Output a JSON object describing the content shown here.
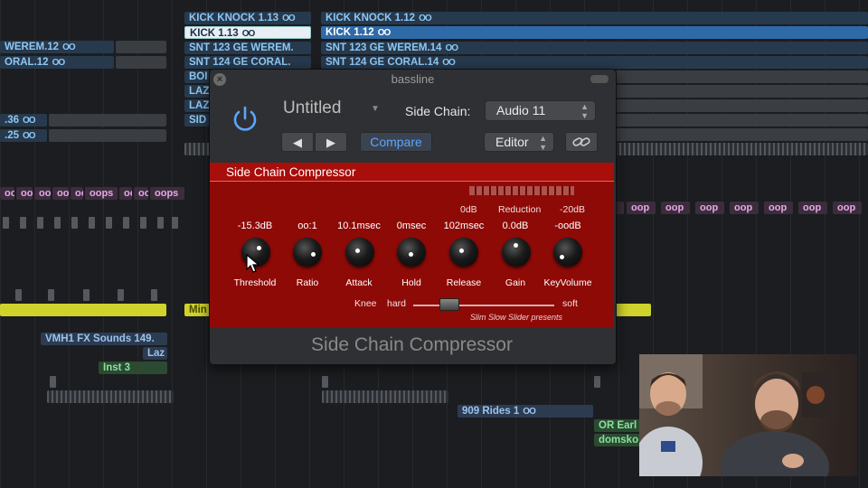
{
  "tracks": {
    "left_regions": [
      {
        "label": "WEREM.12",
        "link": "OO"
      },
      {
        "label": "ORAL.12",
        "link": "OO"
      },
      {
        "label": ".36",
        "link": "OO"
      },
      {
        "label": ".25",
        "link": "OO"
      }
    ],
    "mid_regions": [
      {
        "label": "KICK KNOCK  1.13",
        "link": "OO"
      },
      {
        "label": "KICK  1.13",
        "link": "OO"
      },
      {
        "label": "SNT  123  GE  WEREM.",
        "link": ""
      },
      {
        "label": "SNT  124  GE  CORAL.",
        "link": ""
      },
      {
        "label": "BOI",
        "link": ""
      },
      {
        "label": "LAZ",
        "link": ""
      },
      {
        "label": "LAZ",
        "link": ""
      },
      {
        "label": "SID",
        "link": ""
      }
    ],
    "right_regions": [
      {
        "label": "KICK KNOCK  1.12",
        "link": "OO"
      },
      {
        "label": "KICK  1.12",
        "link": "OO"
      },
      {
        "label": "SNT  123  GE  WEREM.14",
        "link": "OO"
      },
      {
        "label": "SNT  124  GE  CORAL.14",
        "link": "OO"
      }
    ],
    "loop_label": "oops",
    "loop_short": "oo",
    "loop_right": "oop",
    "yellow_label": "Min",
    "vmh_label": "VMH1 FX Sounds 149.",
    "laz_label": "Laz",
    "inst_label": "Inst 3",
    "rides_label": "909 Rides  1",
    "rides_link": "OO",
    "or_label": "OR Earl",
    "dom_label": "domsko"
  },
  "plugin": {
    "window_title": "bassline",
    "preset": "Untitled",
    "side_chain_label": "Side Chain:",
    "side_chain_value": "Audio 11",
    "prev_label": "◀",
    "next_label": "▶",
    "compare_label": "Compare",
    "editor_label": "Editor",
    "header_title": "Side Chain Compressor",
    "meter": {
      "left": "0dB",
      "mid": "Reduction",
      "right": "-20dB"
    },
    "params": [
      {
        "name": "Threshold",
        "value": "-15.3dB"
      },
      {
        "name": "Ratio",
        "value": "oo:1"
      },
      {
        "name": "Attack",
        "value": "10.1msec"
      },
      {
        "name": "Hold",
        "value": "0msec"
      },
      {
        "name": "Release",
        "value": "102msec"
      },
      {
        "name": "Gain",
        "value": "0.0dB"
      },
      {
        "name": "KeyVolume",
        "value": "-oodB"
      }
    ],
    "knee_label": "Knee",
    "knee_hard": "hard",
    "knee_soft": "soft",
    "credit": "Slim Slow Slider presents",
    "footer_title": "Side Chain Compressor"
  },
  "colors": {
    "panel_red": "#8e0a07",
    "compare_blue": "#5aa6ff",
    "region_blue_text": "#8ec7f4",
    "loop_pink": "#e8a8e8",
    "region_yellow": "#cfd32c",
    "region_green_text": "#86e39a"
  }
}
